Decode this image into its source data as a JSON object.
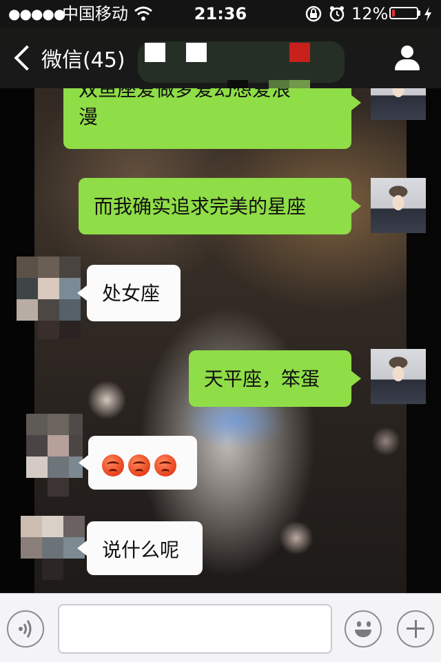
{
  "statusbar": {
    "signal": "●●●●●",
    "carrier": "中国移动",
    "time": "21:36",
    "battery_percent": "12%",
    "battery_level": 0.12,
    "battery_color": "#e53030",
    "icons": [
      "wifi-icon",
      "rotation-lock-icon",
      "alarm-icon",
      "battery-icon",
      "charging-icon"
    ]
  },
  "navbar": {
    "back_label": "微信(45)",
    "back_icon": "chevron-left-icon",
    "profile_icon": "person-icon"
  },
  "colors": {
    "bubble_out": "#8fdd47",
    "bubble_in": "#fbfbfb",
    "navbar": "#181818"
  },
  "messages": [
    {
      "direction": "out",
      "text": "双鱼座爱做梦爱幻想爱浪漫",
      "text_line1": "双鱼座爱做梦爱幻想爱浪",
      "text_line2": "漫"
    },
    {
      "direction": "out",
      "text": "而我确实追求完美的星座"
    },
    {
      "direction": "in",
      "text": "处女座"
    },
    {
      "direction": "out",
      "text": "天平座，笨蛋"
    },
    {
      "direction": "in",
      "text": "",
      "emoji": [
        "angry-face-emoji",
        "angry-face-emoji",
        "angry-face-emoji"
      ]
    },
    {
      "direction": "in",
      "text": "说什么呢"
    }
  ],
  "inputbar": {
    "voice_icon": "voice-icon",
    "emoji_icon": "smiley-icon",
    "plus_icon": "plus-icon",
    "input_value": ""
  }
}
